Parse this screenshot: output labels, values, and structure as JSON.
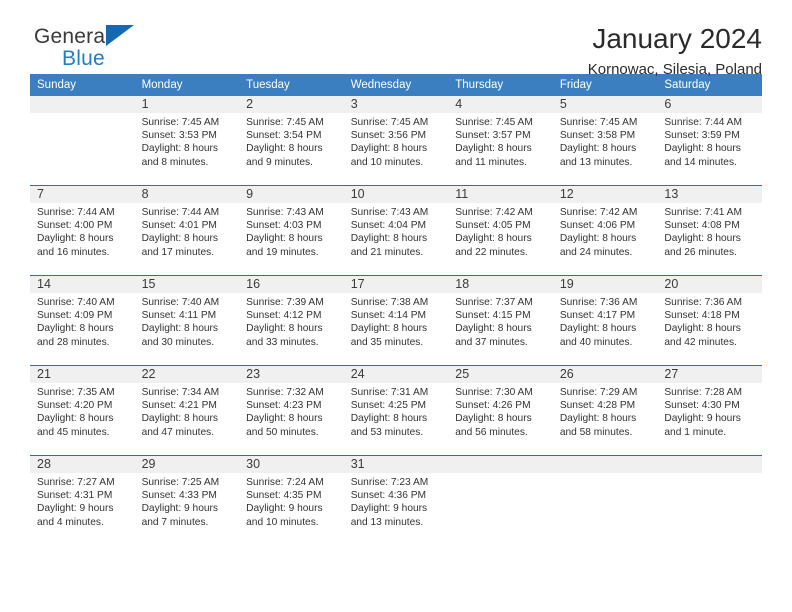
{
  "brand": {
    "name_top": "General",
    "name_bottom": "Blue",
    "accent_color": "#1f7ec4",
    "triangle_color": "#1669b0"
  },
  "header": {
    "title": "January 2024",
    "subtitle": "Kornowac, Silesia, Poland"
  },
  "calendar": {
    "header_bg": "#3b7fc0",
    "daynum_bg": "#f0f0f0",
    "row_border_color": "#2f6fad",
    "weekdays": [
      "Sunday",
      "Monday",
      "Tuesday",
      "Wednesday",
      "Thursday",
      "Friday",
      "Saturday"
    ],
    "weeks": [
      [
        {
          "day": "",
          "sunrise": "",
          "sunset": "",
          "daylight1": "",
          "daylight2": ""
        },
        {
          "day": "1",
          "sunrise": "Sunrise: 7:45 AM",
          "sunset": "Sunset: 3:53 PM",
          "daylight1": "Daylight: 8 hours",
          "daylight2": "and 8 minutes."
        },
        {
          "day": "2",
          "sunrise": "Sunrise: 7:45 AM",
          "sunset": "Sunset: 3:54 PM",
          "daylight1": "Daylight: 8 hours",
          "daylight2": "and 9 minutes."
        },
        {
          "day": "3",
          "sunrise": "Sunrise: 7:45 AM",
          "sunset": "Sunset: 3:56 PM",
          "daylight1": "Daylight: 8 hours",
          "daylight2": "and 10 minutes."
        },
        {
          "day": "4",
          "sunrise": "Sunrise: 7:45 AM",
          "sunset": "Sunset: 3:57 PM",
          "daylight1": "Daylight: 8 hours",
          "daylight2": "and 11 minutes."
        },
        {
          "day": "5",
          "sunrise": "Sunrise: 7:45 AM",
          "sunset": "Sunset: 3:58 PM",
          "daylight1": "Daylight: 8 hours",
          "daylight2": "and 13 minutes."
        },
        {
          "day": "6",
          "sunrise": "Sunrise: 7:44 AM",
          "sunset": "Sunset: 3:59 PM",
          "daylight1": "Daylight: 8 hours",
          "daylight2": "and 14 minutes."
        }
      ],
      [
        {
          "day": "7",
          "sunrise": "Sunrise: 7:44 AM",
          "sunset": "Sunset: 4:00 PM",
          "daylight1": "Daylight: 8 hours",
          "daylight2": "and 16 minutes."
        },
        {
          "day": "8",
          "sunrise": "Sunrise: 7:44 AM",
          "sunset": "Sunset: 4:01 PM",
          "daylight1": "Daylight: 8 hours",
          "daylight2": "and 17 minutes."
        },
        {
          "day": "9",
          "sunrise": "Sunrise: 7:43 AM",
          "sunset": "Sunset: 4:03 PM",
          "daylight1": "Daylight: 8 hours",
          "daylight2": "and 19 minutes."
        },
        {
          "day": "10",
          "sunrise": "Sunrise: 7:43 AM",
          "sunset": "Sunset: 4:04 PM",
          "daylight1": "Daylight: 8 hours",
          "daylight2": "and 21 minutes."
        },
        {
          "day": "11",
          "sunrise": "Sunrise: 7:42 AM",
          "sunset": "Sunset: 4:05 PM",
          "daylight1": "Daylight: 8 hours",
          "daylight2": "and 22 minutes."
        },
        {
          "day": "12",
          "sunrise": "Sunrise: 7:42 AM",
          "sunset": "Sunset: 4:06 PM",
          "daylight1": "Daylight: 8 hours",
          "daylight2": "and 24 minutes."
        },
        {
          "day": "13",
          "sunrise": "Sunrise: 7:41 AM",
          "sunset": "Sunset: 4:08 PM",
          "daylight1": "Daylight: 8 hours",
          "daylight2": "and 26 minutes."
        }
      ],
      [
        {
          "day": "14",
          "sunrise": "Sunrise: 7:40 AM",
          "sunset": "Sunset: 4:09 PM",
          "daylight1": "Daylight: 8 hours",
          "daylight2": "and 28 minutes."
        },
        {
          "day": "15",
          "sunrise": "Sunrise: 7:40 AM",
          "sunset": "Sunset: 4:11 PM",
          "daylight1": "Daylight: 8 hours",
          "daylight2": "and 30 minutes."
        },
        {
          "day": "16",
          "sunrise": "Sunrise: 7:39 AM",
          "sunset": "Sunset: 4:12 PM",
          "daylight1": "Daylight: 8 hours",
          "daylight2": "and 33 minutes."
        },
        {
          "day": "17",
          "sunrise": "Sunrise: 7:38 AM",
          "sunset": "Sunset: 4:14 PM",
          "daylight1": "Daylight: 8 hours",
          "daylight2": "and 35 minutes."
        },
        {
          "day": "18",
          "sunrise": "Sunrise: 7:37 AM",
          "sunset": "Sunset: 4:15 PM",
          "daylight1": "Daylight: 8 hours",
          "daylight2": "and 37 minutes."
        },
        {
          "day": "19",
          "sunrise": "Sunrise: 7:36 AM",
          "sunset": "Sunset: 4:17 PM",
          "daylight1": "Daylight: 8 hours",
          "daylight2": "and 40 minutes."
        },
        {
          "day": "20",
          "sunrise": "Sunrise: 7:36 AM",
          "sunset": "Sunset: 4:18 PM",
          "daylight1": "Daylight: 8 hours",
          "daylight2": "and 42 minutes."
        }
      ],
      [
        {
          "day": "21",
          "sunrise": "Sunrise: 7:35 AM",
          "sunset": "Sunset: 4:20 PM",
          "daylight1": "Daylight: 8 hours",
          "daylight2": "and 45 minutes."
        },
        {
          "day": "22",
          "sunrise": "Sunrise: 7:34 AM",
          "sunset": "Sunset: 4:21 PM",
          "daylight1": "Daylight: 8 hours",
          "daylight2": "and 47 minutes."
        },
        {
          "day": "23",
          "sunrise": "Sunrise: 7:32 AM",
          "sunset": "Sunset: 4:23 PM",
          "daylight1": "Daylight: 8 hours",
          "daylight2": "and 50 minutes."
        },
        {
          "day": "24",
          "sunrise": "Sunrise: 7:31 AM",
          "sunset": "Sunset: 4:25 PM",
          "daylight1": "Daylight: 8 hours",
          "daylight2": "and 53 minutes."
        },
        {
          "day": "25",
          "sunrise": "Sunrise: 7:30 AM",
          "sunset": "Sunset: 4:26 PM",
          "daylight1": "Daylight: 8 hours",
          "daylight2": "and 56 minutes."
        },
        {
          "day": "26",
          "sunrise": "Sunrise: 7:29 AM",
          "sunset": "Sunset: 4:28 PM",
          "daylight1": "Daylight: 8 hours",
          "daylight2": "and 58 minutes."
        },
        {
          "day": "27",
          "sunrise": "Sunrise: 7:28 AM",
          "sunset": "Sunset: 4:30 PM",
          "daylight1": "Daylight: 9 hours",
          "daylight2": "and 1 minute."
        }
      ],
      [
        {
          "day": "28",
          "sunrise": "Sunrise: 7:27 AM",
          "sunset": "Sunset: 4:31 PM",
          "daylight1": "Daylight: 9 hours",
          "daylight2": "and 4 minutes."
        },
        {
          "day": "29",
          "sunrise": "Sunrise: 7:25 AM",
          "sunset": "Sunset: 4:33 PM",
          "daylight1": "Daylight: 9 hours",
          "daylight2": "and 7 minutes."
        },
        {
          "day": "30",
          "sunrise": "Sunrise: 7:24 AM",
          "sunset": "Sunset: 4:35 PM",
          "daylight1": "Daylight: 9 hours",
          "daylight2": "and 10 minutes."
        },
        {
          "day": "31",
          "sunrise": "Sunrise: 7:23 AM",
          "sunset": "Sunset: 4:36 PM",
          "daylight1": "Daylight: 9 hours",
          "daylight2": "and 13 minutes."
        },
        {
          "day": "",
          "sunrise": "",
          "sunset": "",
          "daylight1": "",
          "daylight2": ""
        },
        {
          "day": "",
          "sunrise": "",
          "sunset": "",
          "daylight1": "",
          "daylight2": ""
        },
        {
          "day": "",
          "sunrise": "",
          "sunset": "",
          "daylight1": "",
          "daylight2": ""
        }
      ]
    ]
  }
}
